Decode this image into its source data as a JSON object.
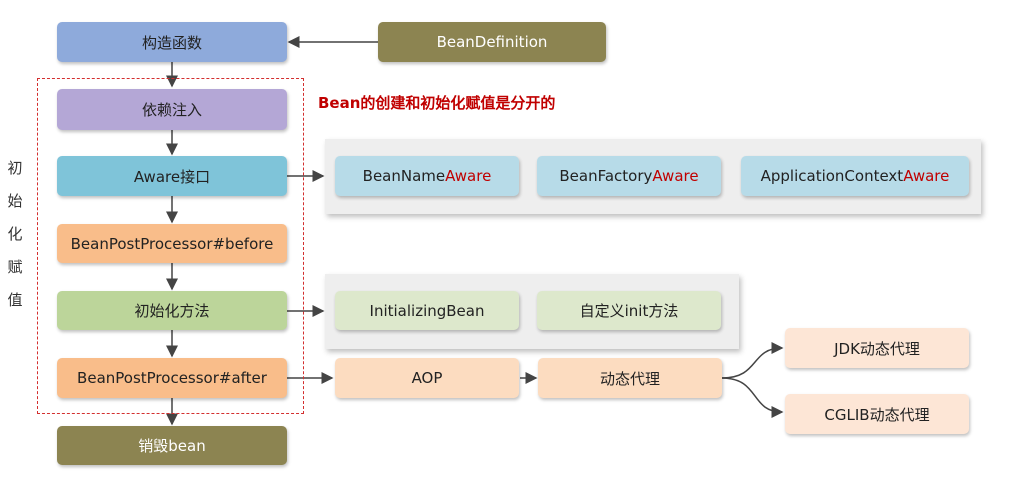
{
  "side_label": [
    "初",
    "始",
    "化",
    "赋",
    "值"
  ],
  "note": "Bean的创建和初始化赋值是分开的",
  "steps": {
    "constructor": "构造函数",
    "bean_definition": "BeanDefinition",
    "inject": "依赖注入",
    "aware": "Aware接口",
    "bpp_before": "BeanPostProcessor#before",
    "init_method": "初始化方法",
    "bpp_after": "BeanPostProcessor#after",
    "destroy": "销毁bean"
  },
  "aware_items": [
    {
      "prefix": "BeanName",
      "suffix": "Aware"
    },
    {
      "prefix": "BeanFactory",
      "suffix": "Aware"
    },
    {
      "prefix": "ApplicationContext",
      "suffix": "Aware"
    }
  ],
  "init_items": [
    "InitializingBean",
    "自定义init方法"
  ],
  "after_items": {
    "aop": "AOP",
    "dynamic_proxy": "动态代理",
    "jdk_proxy": "JDK动态代理",
    "cglib_proxy": "CGLIB动态代理"
  },
  "colors": {
    "blue": "#8eaadb",
    "olive": "#8c8451",
    "purple": "#b4a7d6",
    "teal": "#7fc4d9",
    "orange": "#f9bd8a",
    "green": "#bcd59a",
    "light_teal": "#b7dbe8",
    "light_green": "#dde8cc",
    "light_orange": "#fcdcc0",
    "peach": "#fde6d6",
    "accent_red": "#c00000"
  }
}
